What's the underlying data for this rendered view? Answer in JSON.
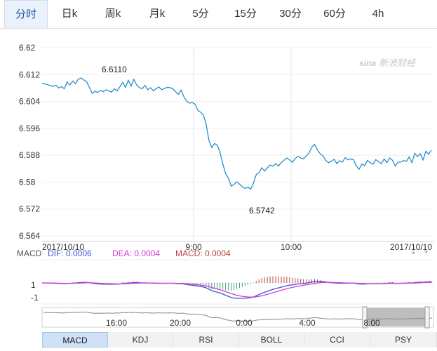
{
  "tabs": [
    {
      "label": "分时",
      "active": true
    },
    {
      "label": "日k"
    },
    {
      "label": "周k"
    },
    {
      "label": "月k"
    },
    {
      "label": "5分"
    },
    {
      "label": "15分"
    },
    {
      "label": "30分"
    },
    {
      "label": "60分"
    },
    {
      "label": "4h"
    }
  ],
  "watermark": "新浪财经",
  "chart_data": {
    "type": "line",
    "yticks": [
      "6.62",
      "6.612",
      "6.604",
      "6.596",
      "6.588",
      "6.58",
      "6.572",
      "6.564"
    ],
    "ylim": [
      6.564,
      6.62
    ],
    "x_labels": [
      "2017/10/10",
      "9:00",
      "10:00",
      "2017/10/10"
    ],
    "annotations": {
      "high": "6.6110",
      "low": "6.5742"
    },
    "line_color": "#1a86c8",
    "series": [
      {
        "x": [
          0,
          4,
          8,
          12,
          16,
          20,
          24,
          28,
          32,
          36,
          40,
          44,
          48,
          52,
          56,
          60,
          64,
          68,
          72,
          76,
          80,
          84,
          88,
          92,
          96,
          100,
          104,
          108,
          112,
          116,
          120,
          124,
          128,
          132,
          136,
          140,
          144,
          148,
          152,
          156,
          160,
          164,
          168,
          172,
          176,
          180,
          184,
          188,
          192,
          196,
          200,
          204,
          208,
          212,
          216,
          220,
          224,
          228,
          232,
          236,
          240,
          244,
          248,
          252,
          256,
          260,
          264,
          268,
          272,
          276,
          280,
          284,
          288,
          292,
          296,
          300,
          304,
          308,
          312,
          316,
          320,
          324,
          328,
          332,
          336,
          340,
          344,
          348,
          352,
          356,
          360,
          364,
          368,
          372,
          376,
          380,
          384,
          388,
          392,
          396,
          400,
          404,
          408,
          412,
          416,
          420,
          424,
          428,
          432,
          436,
          440,
          444,
          448,
          452,
          456,
          460,
          464,
          468,
          472,
          476,
          480,
          484,
          488,
          492,
          496,
          500,
          504,
          508,
          512,
          516,
          520,
          524,
          528,
          532,
          536,
          540,
          544,
          548,
          552,
          556,
          560
        ],
        "values": [
          6.6095,
          6.6092,
          6.609,
          6.6087,
          6.6085,
          6.6088,
          6.608,
          6.6084,
          6.6078,
          6.6098,
          6.6089,
          6.6101,
          6.6093,
          6.6106,
          6.611,
          6.6104,
          6.6099,
          6.6082,
          6.6064,
          6.607,
          6.6067,
          6.6073,
          6.6069,
          6.6075,
          6.6072,
          6.6068,
          6.6078,
          6.6072,
          6.6084,
          6.6097,
          6.6082,
          6.6103,
          6.6086,
          6.6106,
          6.6089,
          6.6081,
          6.6078,
          6.6088,
          6.6075,
          6.6081,
          6.6072,
          6.6078,
          6.6083,
          6.6075,
          6.6079,
          6.6082,
          6.6081,
          6.6078,
          6.6069,
          6.6061,
          6.6074,
          6.6054,
          6.6041,
          6.6035,
          6.6037,
          6.6032,
          6.6014,
          6.6008,
          6.6,
          6.5972,
          6.5924,
          6.5903,
          6.5915,
          6.591,
          6.5888,
          6.5854,
          6.5826,
          6.5812,
          6.5788,
          6.5793,
          6.5801,
          6.5794,
          6.5786,
          6.5781,
          6.5785,
          6.5779,
          6.5797,
          6.5822,
          6.5828,
          6.5843,
          6.5833,
          6.5842,
          6.5851,
          6.5847,
          6.5855,
          6.5848,
          6.5858,
          6.5865,
          6.5872,
          6.5866,
          6.5859,
          6.587,
          6.5877,
          6.5872,
          6.5869,
          6.5878,
          6.5887,
          6.5904,
          6.5912,
          6.5896,
          6.5885,
          6.5878,
          6.5865,
          6.5858,
          6.5862,
          6.5868,
          6.5855,
          6.5864,
          6.5859,
          6.5873,
          6.5866,
          6.5869,
          6.5867,
          6.5848,
          6.5838,
          6.5854,
          6.5849,
          6.5865,
          6.5858,
          6.5853,
          6.5867,
          6.5861,
          6.5855,
          6.5869,
          6.5858,
          6.5872,
          6.5865,
          6.5848,
          6.5859,
          6.586,
          6.5864,
          6.5862,
          6.5875,
          6.5858,
          6.5886,
          6.5876,
          6.5885,
          6.5866,
          6.5892,
          6.5883,
          6.5895
        ]
      }
    ]
  },
  "macd": {
    "label": "MACD",
    "dif": "DIF: 0.0006",
    "dea": "DEA: 0.0004",
    "macd": "MACD: 0.0004",
    "colors": {
      "dif": "#3a55d8",
      "dea": "#d23cd2",
      "macd": "#b84545"
    },
    "yticks": [
      "1",
      "-1"
    ]
  },
  "navigator": {
    "labels": [
      "16:00",
      "20:00",
      "0:00",
      "4:00",
      "8:00"
    ]
  },
  "bottom_tabs": [
    {
      "label": "MACD",
      "active": true
    },
    {
      "label": "KDJ"
    },
    {
      "label": "RSI"
    },
    {
      "label": "BOLL"
    },
    {
      "label": "CCI"
    },
    {
      "label": "PSY"
    }
  ]
}
